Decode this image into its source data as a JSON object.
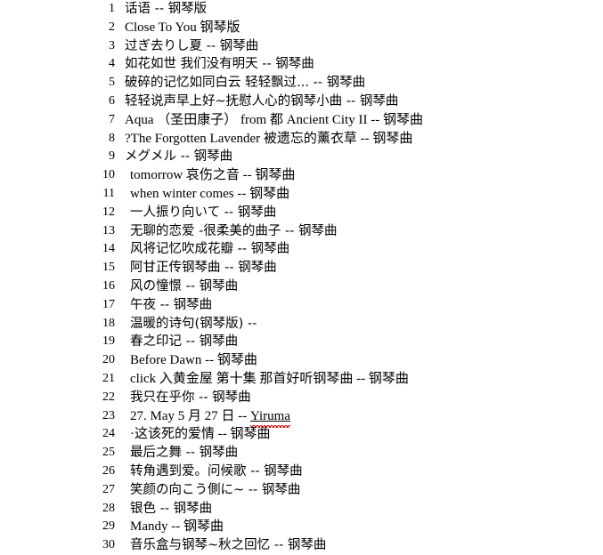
{
  "page": {
    "background_color": "#ffffff",
    "text_color": "#000000",
    "spellcheck_underline_color": "#d01010",
    "total_items": 30
  },
  "list": {
    "items": [
      {
        "number": "1",
        "title": "话语  --  钢琴版"
      },
      {
        "number": "2",
        "title": "Close To You 钢琴版"
      },
      {
        "number": "3",
        "title": "过ぎ去りし夏  --  钢琴曲"
      },
      {
        "number": "4",
        "title": "如花如世  我们没有明天  --  钢琴曲"
      },
      {
        "number": "5",
        "title": "破碎的记忆如同白云  轻轻飘过... --  钢琴曲"
      },
      {
        "number": "6",
        "title": "轻轻说声早上好~抚慰人心的钢琴小曲  --  钢琴曲"
      },
      {
        "number": "7",
        "title": "Aqua  （圣田康子）  from  都  Ancient City II --  钢琴曲"
      },
      {
        "number": "8",
        "title": "?The Forgotten Lavender 被遗忘的薰衣草  --  钢琴曲"
      },
      {
        "number": "9",
        "title": "メグメル  --  钢琴曲"
      },
      {
        "number": "10",
        "title": "tomorrow 哀伤之音  --  钢琴曲"
      },
      {
        "number": "11",
        "title": "when winter comes --  钢琴曲"
      },
      {
        "number": "12",
        "title": "一人振り向いて  --  钢琴曲"
      },
      {
        "number": "13",
        "title": "无聊的恋爱  -很柔美的曲子  --  钢琴曲"
      },
      {
        "number": "14",
        "title": "风将记忆吹成花瓣  --  钢琴曲"
      },
      {
        "number": "15",
        "title": "阿甘正传钢琴曲  --  钢琴曲"
      },
      {
        "number": "16",
        "title": "风の憧憬  --  钢琴曲"
      },
      {
        "number": "17",
        "title": "午夜  --  钢琴曲"
      },
      {
        "number": "18",
        "title": "温暖的诗句(钢琴版) --"
      },
      {
        "number": "19",
        "title": "春之印记  --  钢琴曲"
      },
      {
        "number": "20",
        "title": "Before Dawn --  钢琴曲"
      },
      {
        "number": "21",
        "title": "click 入黄金屋  第十集  那首好听钢琴曲  --  钢琴曲"
      },
      {
        "number": "22",
        "title": "我只在乎你  --  钢琴曲"
      },
      {
        "number": "23",
        "title": "27. May 5 月 27 日  -- ",
        "misspelled_word": "Yiruma"
      },
      {
        "number": "24",
        "title": "·这该死的爱情  --  钢琴曲"
      },
      {
        "number": "25",
        "title": "最后之舞  --  钢琴曲"
      },
      {
        "number": "26",
        "title": "转角遇到爱。问候歌  --  钢琴曲"
      },
      {
        "number": "27",
        "title": "笑颜の向こう側に~  --  钢琴曲"
      },
      {
        "number": "28",
        "title": "银色  --  钢琴曲"
      },
      {
        "number": "29",
        "title": "Mandy --  钢琴曲"
      },
      {
        "number": "30",
        "title": "音乐盒与钢琴~秋之回忆  --  钢琴曲"
      }
    ]
  }
}
